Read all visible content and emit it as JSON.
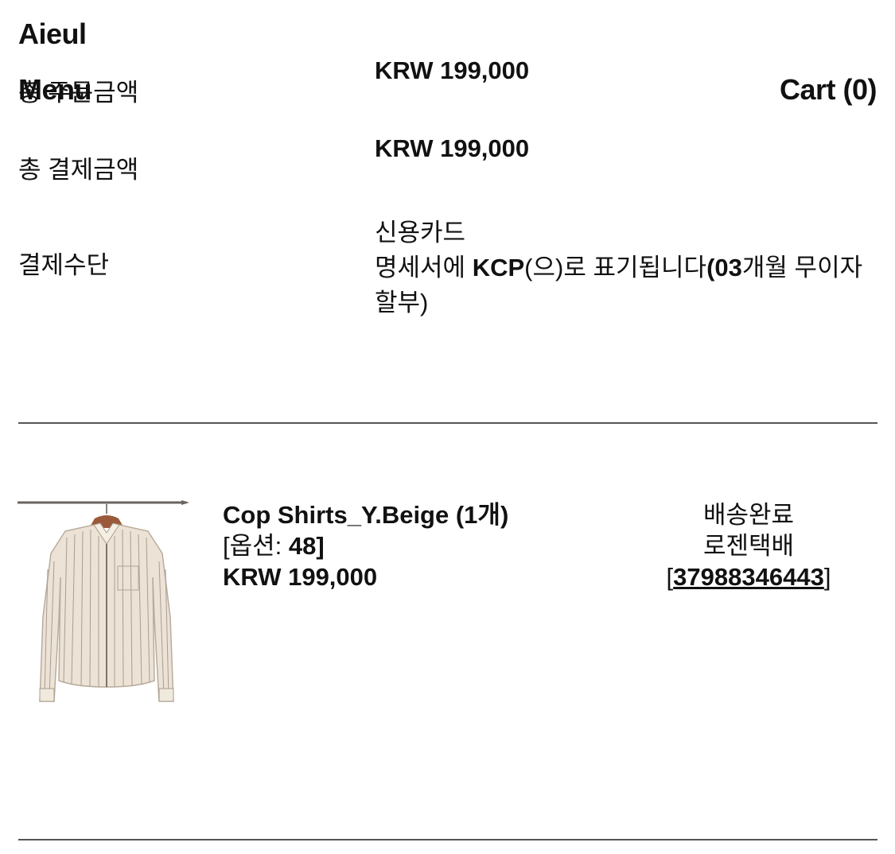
{
  "header": {
    "brand": "Aieul",
    "menu_label": "Menu",
    "cart_label": "Cart (0)"
  },
  "summary": {
    "order_total_label": "총 주문금액",
    "order_total_value": "KRW 199,000",
    "payment_total_label": "총 결제금액",
    "payment_total_value": "KRW 199,000",
    "payment_method_label": "결제수단",
    "payment_method_card": "신용카드",
    "payment_statement_prefix": "명세서에",
    "payment_statement_company": "KCP",
    "payment_statement_mid": "(으)로 표기됩니다",
    "payment_statement_installment": "(03",
    "payment_statement_suffix": "개월 무이자 할부)"
  },
  "order_item": {
    "image_icon": "shirt-on-hanger-image",
    "name_text": "Cop Shirts_Y.Beige (1",
    "name_unit": "개)",
    "option_open": "[옵션:",
    "option_value": "48]",
    "price": "KRW 199,000",
    "status": "배송완료",
    "courier": "로젠택배",
    "tracking_open": "[",
    "tracking_number": "37988346443",
    "tracking_close": "]"
  }
}
